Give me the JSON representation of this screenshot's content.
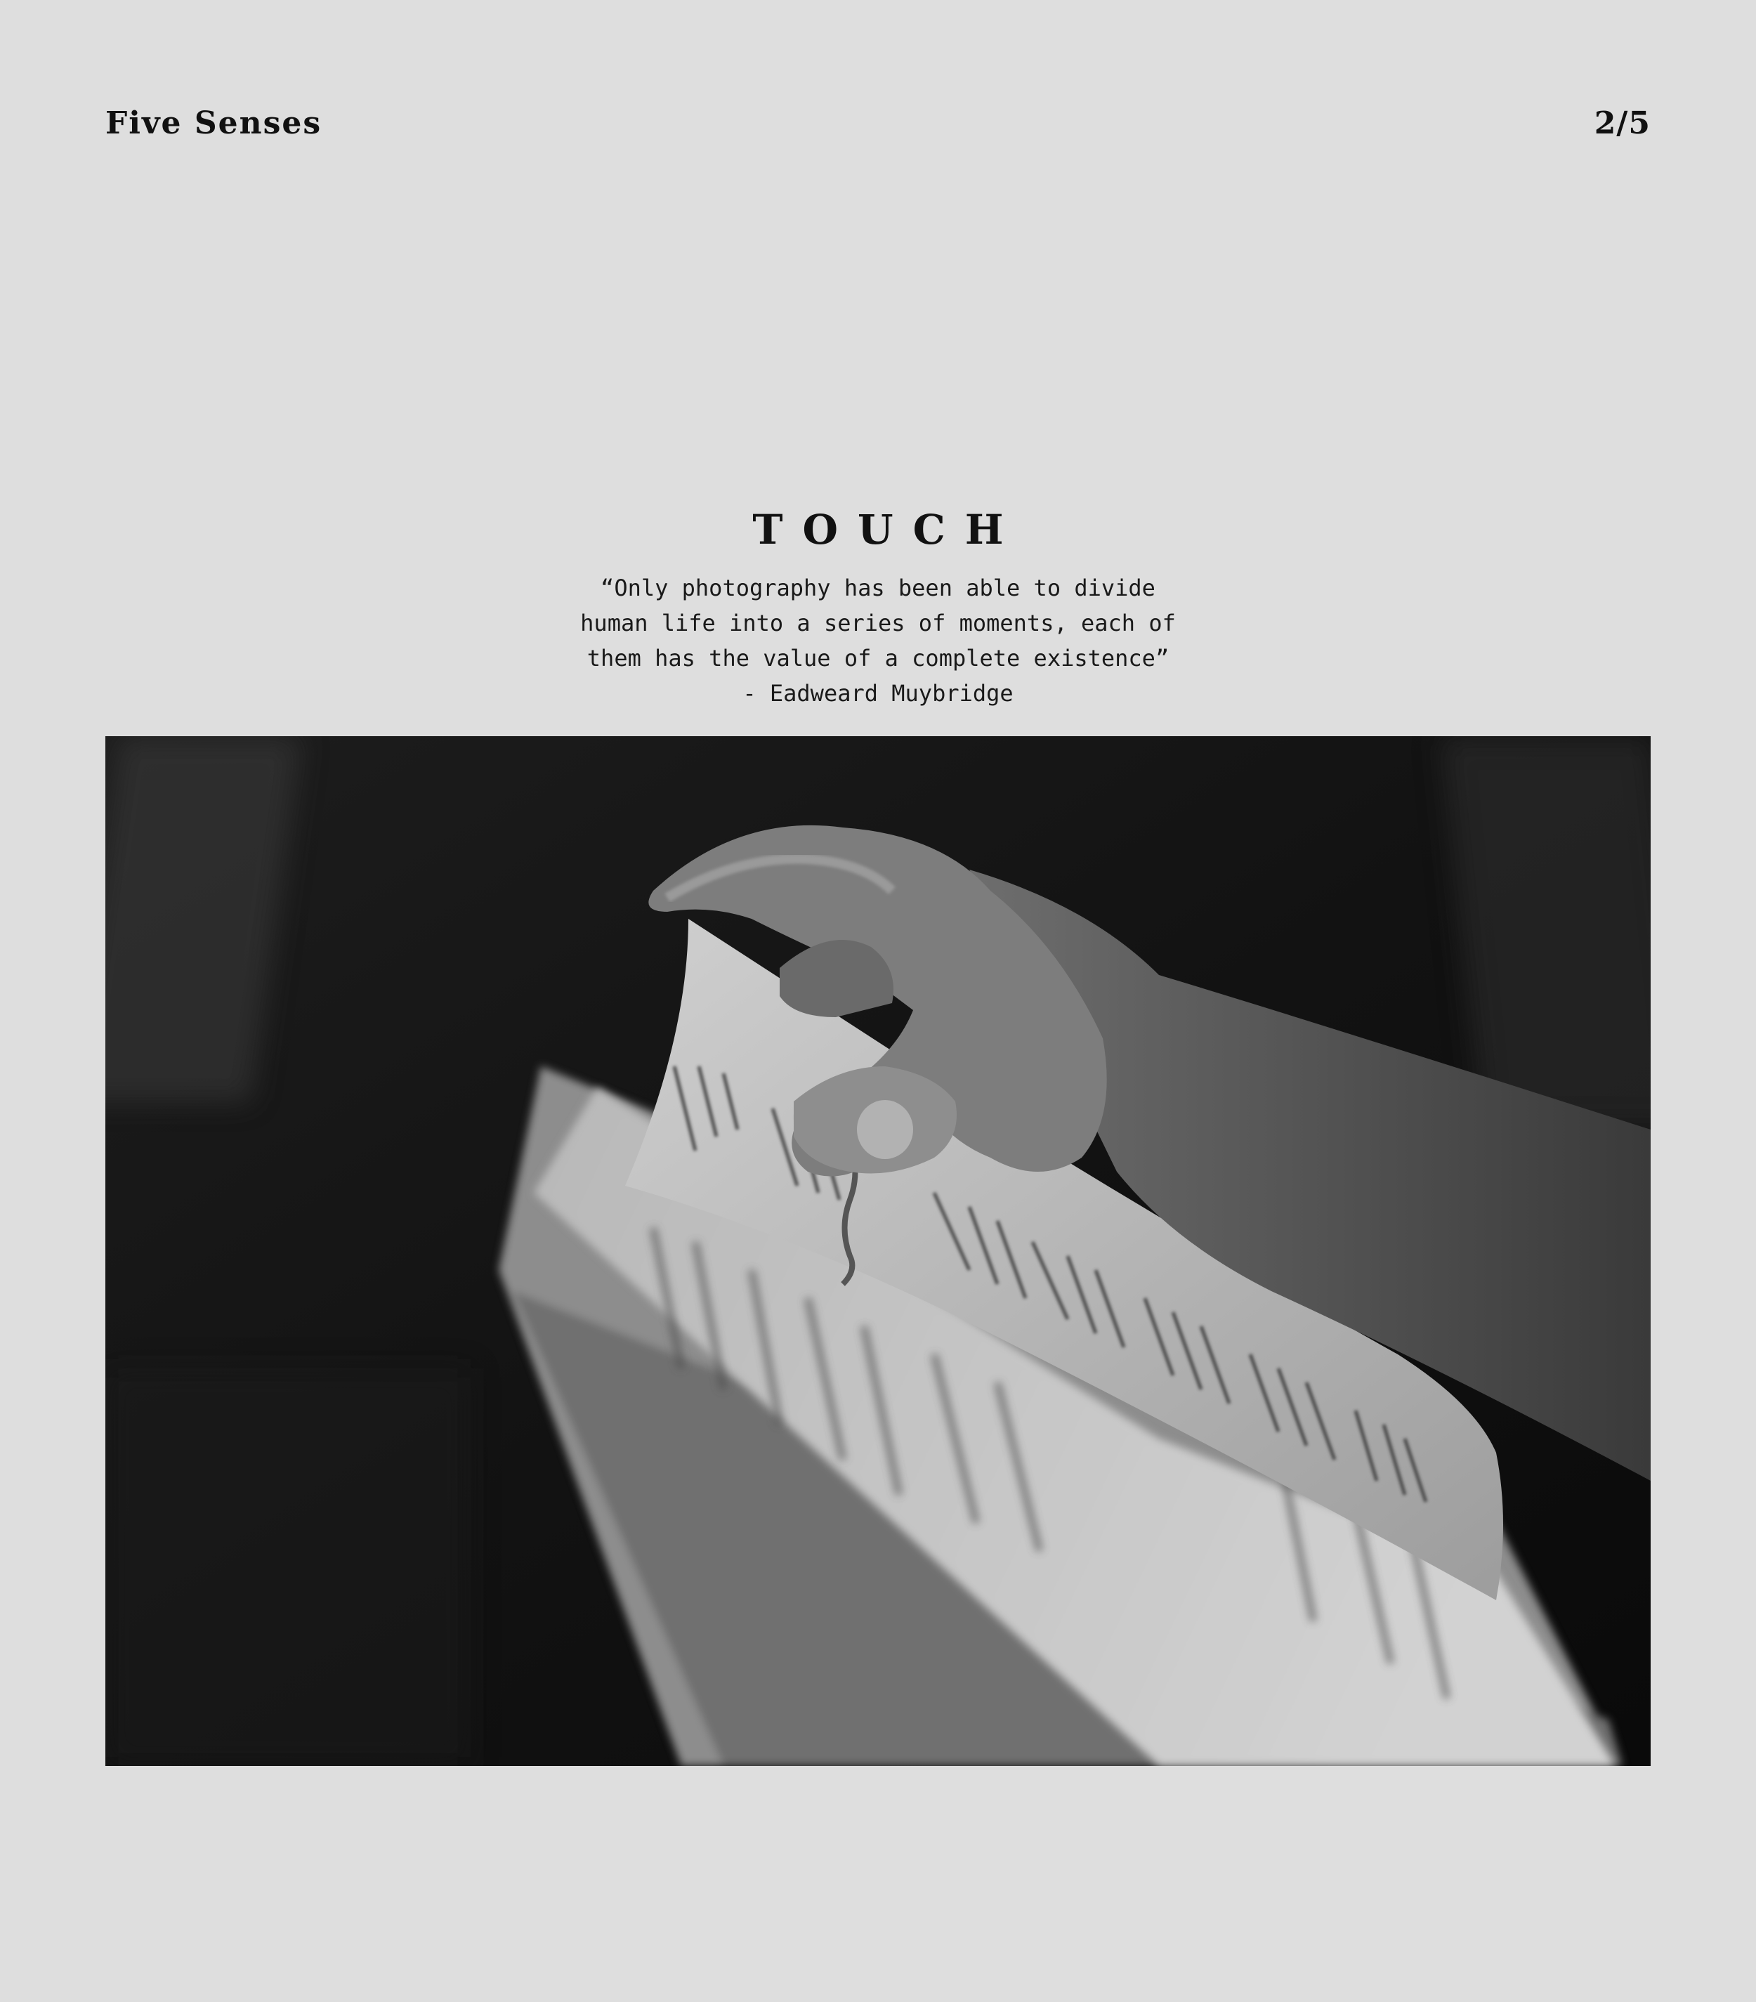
{
  "header": {
    "title": "Five Senses",
    "page_indicator": "2/5"
  },
  "section": {
    "title": "TOUCH"
  },
  "quote": {
    "lines": [
      "“Only photography has been able to divide",
      "human life into a series of moments, each of",
      "them has the value of a complete existence”"
    ],
    "attribution": "- Eadweard Muybridge"
  },
  "photo": {
    "description_icon": "photo-hand-turning-book-page"
  }
}
